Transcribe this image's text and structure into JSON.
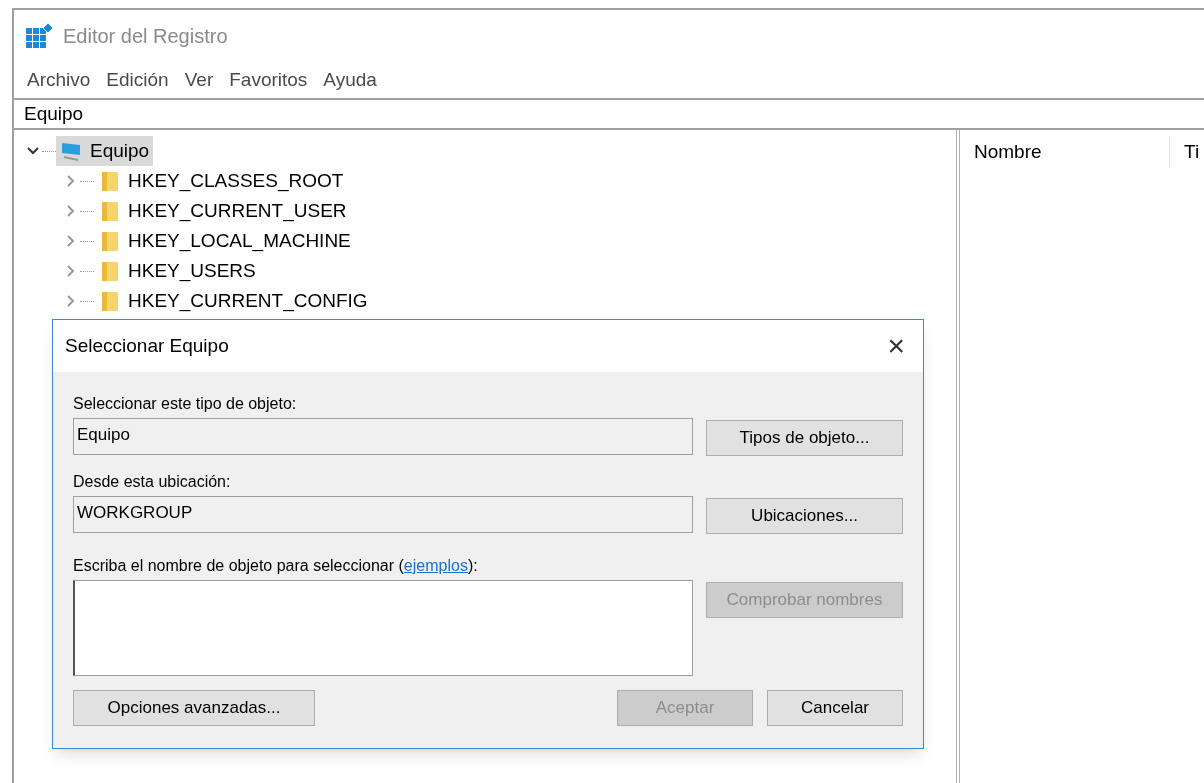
{
  "window": {
    "title": "Editor del Registro"
  },
  "menu": [
    "Archivo",
    "Edición",
    "Ver",
    "Favoritos",
    "Ayuda"
  ],
  "address": "Equipo",
  "tree": {
    "label": "Equipo",
    "expanded": true,
    "selected": true,
    "children": [
      {
        "label": "HKEY_CLASSES_ROOT",
        "expanded": false,
        "selected": false
      },
      {
        "label": "HKEY_CURRENT_USER",
        "expanded": false,
        "selected": false
      },
      {
        "label": "HKEY_LOCAL_MACHINE",
        "expanded": false,
        "selected": false
      },
      {
        "label": "HKEY_USERS",
        "expanded": false,
        "selected": false
      },
      {
        "label": "HKEY_CURRENT_CONFIG",
        "expanded": false,
        "selected": false
      }
    ]
  },
  "list": {
    "columns": [
      "Nombre",
      "Ti"
    ]
  },
  "dialog": {
    "title": "Seleccionar Equipo",
    "close": "×",
    "object_type": {
      "label": "Seleccionar este tipo de objeto:",
      "value": "Equipo",
      "button": {
        "label": "Tipos de objeto...",
        "disabled": false
      }
    },
    "location": {
      "label": "Desde esta ubicación:",
      "value": "WORKGROUP",
      "button": {
        "label": "Ubicaciones...",
        "disabled": false
      }
    },
    "name_entry": {
      "label_before": "Escriba el nombre de objeto para seleccionar (",
      "link": "ejemplos",
      "label_after": "):",
      "button": {
        "label": "Comprobar nombres",
        "disabled": true
      }
    },
    "footer_buttons": [
      {
        "label": "Opciones avanzadas...",
        "disabled": false
      },
      {
        "label": "Aceptar",
        "disabled": true
      },
      {
        "label": "Cancelar",
        "disabled": false
      }
    ]
  }
}
